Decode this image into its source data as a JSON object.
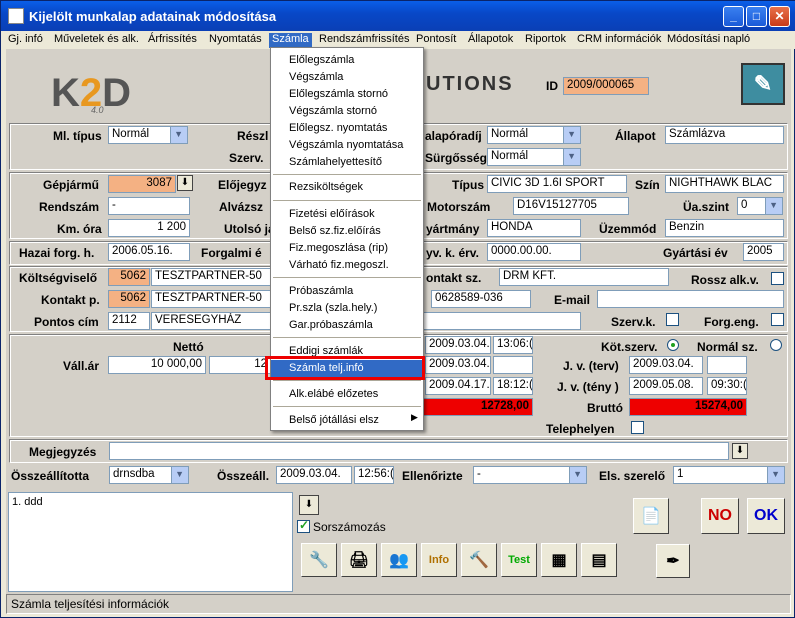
{
  "window": {
    "title": "Kijelölt munkalap adatainak módosítása"
  },
  "menu": [
    "Gj. infó",
    "Műveletek és alk.",
    "Árfrissítés",
    "Nyomtatás",
    "Számla",
    "Rendszámfrissítés",
    "Pontosít",
    "Állapotok",
    "Riportok",
    "CRM információk",
    "Módosítási napló"
  ],
  "dropdown": [
    "Előlegszámla",
    "Végszámla",
    "Előlegszámla stornó",
    "Végszámla stornó",
    "Előlegsz. nyomtatás",
    "Végszámla nyomtatása",
    "Számlahelyettesítő",
    "Rezsiköltségek",
    "Fizetési előírások",
    "Belső sz.fiz.előírás",
    "Fiz.megoszlása (rip)",
    "Várható fiz.megoszl.",
    "Próbaszámla",
    "Pr.szla (szla.hely.)",
    "Gar.próbaszámla",
    "Eddigi számlák",
    "Számla telj.infó",
    "Alk.elábé előzetes",
    "Belső jótállási elsz"
  ],
  "logo": {
    "text_a": "K",
    "text_b": "2",
    "text_c": "D",
    "version": "4.0",
    "solutions": "UTIONS"
  },
  "id": {
    "label": "ID",
    "value": "2009/000065"
  },
  "fields": {
    "ml_tipus_label": "Ml. típus",
    "ml_tipus": "Normál",
    "resz_label": "Részl",
    "szerv_label": "Szerv.",
    "alaporadij_label": "alapóradíj",
    "alaporadij": "Normál",
    "allapot_label": "Állapot",
    "allapot": "Számlázva",
    "surgosseg_label": "Sürgősség",
    "surgosseg": "Normál",
    "gepjarmu_label": "Gépjármű",
    "gepjarmu": "3087",
    "elojegyz_label": "Előjegyz",
    "tipus_label": "Típus",
    "tipus": "CIVIC 3D 1.6I SPORT",
    "szin_label": "Szín",
    "szin": "NIGHTHAWK BLAC",
    "rendszam_label": "Rendszám",
    "rendszam": "-",
    "alvazsz_label": "Alvázsz",
    "motorszam_label": "Motorszám",
    "motorszam": "D16V15127705",
    "ua_szint_label": "Üa.szint",
    "ua_szint": "0",
    "km_ora_label": "Km. óra",
    "km_ora": "1 200",
    "utolso_label": "Utolsó já",
    "gyartmany_label": "yártmány",
    "gyartmany": "HONDA",
    "uzemmod_label": "Üzemmód",
    "uzemmod": "Benzin",
    "hazai_label": "Hazai forg. h.",
    "hazai": "2006.05.16.",
    "forgalmi_label": "Forgalmi é",
    "muszaki_label": "yv. k. érv.",
    "muszaki": "0000.00.00.",
    "gyartasi_ev_label": "Gyártási év",
    "gyartasi_ev": "2005",
    "koltsegvis_label": "Költségviselő",
    "koltsegvis_id": "5062",
    "koltsegvis": "TESZTPARTNER-50",
    "kontakt_sz_label": "ontakt sz.",
    "kontakt_sz": "DRM KFT.",
    "rossz_label": "Rossz alk.v.",
    "kontakt_p_label": "Kontakt p.",
    "kontakt_p_id": "5062",
    "kontakt_p": "TESZTPARTNER-50",
    "tel": "0628589-036",
    "email_label": "E-mail",
    "pontos_cim_label": "Pontos cím",
    "irsz": "2112",
    "varos": "VERESEGYHÁZ",
    "szervk_label": "Szerv.k.",
    "forg_eng_label": "Forg.eng.",
    "netto_label": "Nettó",
    "vall_ar_label": "Váll.ár",
    "vall_ar": "10 000,00",
    "vall_ar2": "12",
    "date1": "2009.03.04.",
    "time1": "13:06:(",
    "date2": "2009.03.04.",
    "date3": "2009.04.17.",
    "time3": "18:12:(",
    "kot_szerv_label": "Köt.szerv.",
    "normal_sz_label": "Normál sz.",
    "jv_terv_label": "J. v. (terv)",
    "jv_terv": "2009.03.04.",
    "jv_teny_label": "J. v. (tény )",
    "jv_teny": "2009.05.08.",
    "jv_teny_time": "09:30:(",
    "netto_total": "12728,00",
    "brutto_label": "Bruttó",
    "brutto": "15274,00",
    "telephelyen_label": "Telephelyen",
    "megjegyzes_label": "Megjegyzés",
    "osszeallitotta_label": "Összeállította",
    "osszeallitotta": "drnsdba",
    "osszeall_label": "Összeáll.",
    "osszeall": "2009.03.04.",
    "osszeall_time": "12:56:(",
    "ellenorizte_label": "Ellenőrizte",
    "ellenorizte": "-",
    "els_szerelo_label": "Els. szerelő",
    "els_szerelo": "1",
    "memo": "1. ddd",
    "sorszamozas_label": "Sorszámozás"
  },
  "buttons": {
    "no": "NO",
    "ok": "OK",
    "test": "Test",
    "info": "Info"
  },
  "status": "Számla teljesítési információk"
}
